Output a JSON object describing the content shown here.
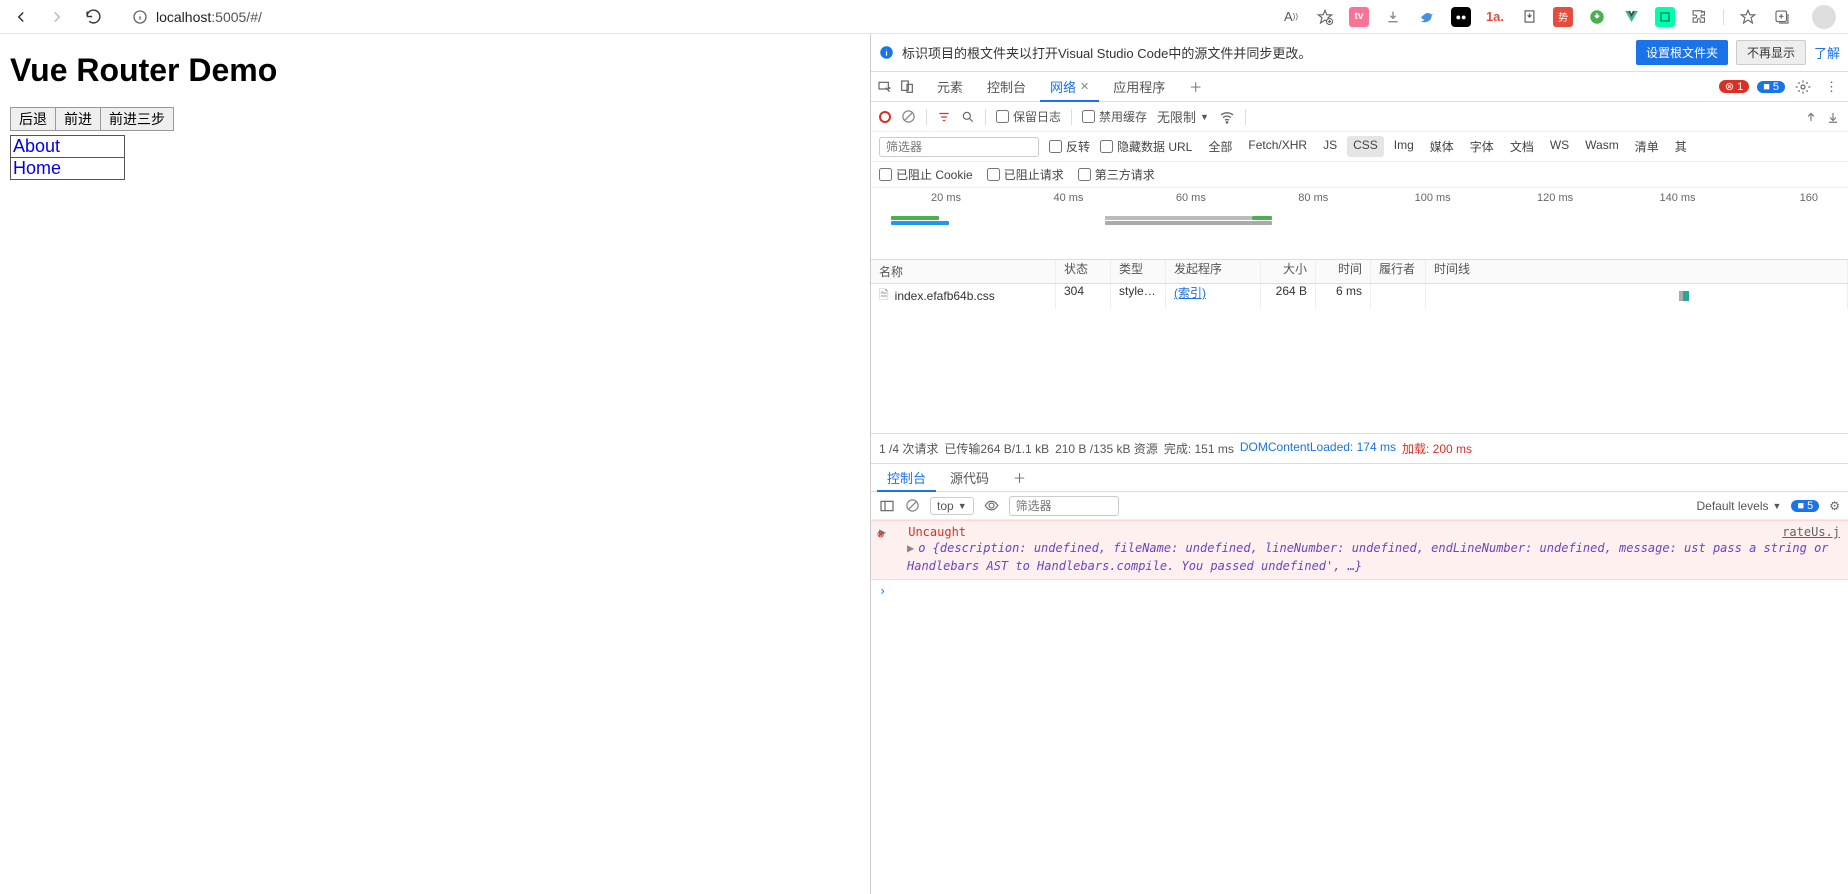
{
  "browser": {
    "url_display_host": "localhost",
    "url_display_path": ":5005/#/",
    "ext_tooltips": [
      "read-aloud",
      "favorite",
      "bilibili",
      "download",
      "bird",
      "dark",
      "tomato",
      "ext1",
      "red-sq",
      "idm",
      "vue",
      "window",
      "puzzle",
      "collections",
      "addtab"
    ]
  },
  "page": {
    "title": "Vue Router Demo",
    "buttons": {
      "back": "后退",
      "fwd": "前进",
      "fwd3": "前进三步"
    },
    "links": {
      "about": "About",
      "home": "Home"
    }
  },
  "devtools": {
    "infobar": {
      "message": "标识项目的根文件夹以打开Visual Studio Code中的源文件并同步更改。",
      "btn_primary": "设置根文件夹",
      "btn_secondary": "不再显示",
      "learn_more": "了解"
    },
    "tabs": {
      "elements": "元素",
      "console": "控制台",
      "network": "网络",
      "application": "应用程序"
    },
    "badges": {
      "errors": "1",
      "info": "5"
    },
    "network": {
      "toolbar": {
        "preserve_log": "保留日志",
        "disable_cache": "禁用缓存",
        "throttling": "无限制"
      },
      "filter_placeholder": "筛选器",
      "filterchk": {
        "invert": "反转",
        "hide_data_url": "隐藏数据 URL"
      },
      "types": {
        "all": "全部",
        "fetchxhr": "Fetch/XHR",
        "js": "JS",
        "css": "CSS",
        "img": "Img",
        "media": "媒体",
        "font": "字体",
        "doc": "文档",
        "ws": "WS",
        "wasm": "Wasm",
        "manifest": "清单",
        "other": "其"
      },
      "cookies": {
        "blocked": "已阻止 Cookie",
        "blocked_req": "已阻止请求",
        "third_party": "第三方请求"
      },
      "timeline_ticks": [
        "20 ms",
        "40 ms",
        "60 ms",
        "80 ms",
        "100 ms",
        "120 ms",
        "140 ms",
        "160"
      ],
      "headers": {
        "name": "名称",
        "status": "状态",
        "type": "类型",
        "initiator": "发起程序",
        "size": "大小",
        "time": "时间",
        "fulfilled": "履行者",
        "waterfall": "时间线"
      },
      "rows": [
        {
          "name": "index.efafb64b.css",
          "status": "304",
          "type": "stylesh...",
          "initiator": "(索引)",
          "size": "264 B",
          "time": "6 ms",
          "fulfilled": ""
        }
      ],
      "status_bar": {
        "req_count": "1 /4 次请求",
        "transferred": "已传输264 B/1.1 kB",
        "resources": "210 B /135 kB 资源",
        "finish_lbl": "完成:",
        "finish": "151 ms",
        "dcl_lbl": "DOMContentLoaded:",
        "dcl": "174 ms",
        "load_lbl": "加载:",
        "load": "200 ms"
      }
    },
    "console_drawer": {
      "tabs": {
        "console": "控制台",
        "sources": "源代码"
      },
      "context": "top",
      "filter_placeholder": "筛选器",
      "levels": "Default levels",
      "issues_count": "5",
      "error": {
        "label": "Uncaught",
        "source": "rateUs.j",
        "detail": "o {description: undefined, fileName: undefined, lineNumber: undefined, endLineNumber: undefined, message:   ust pass a string or Handlebars AST to Handlebars.compile. You passed undefined', …}"
      }
    }
  }
}
